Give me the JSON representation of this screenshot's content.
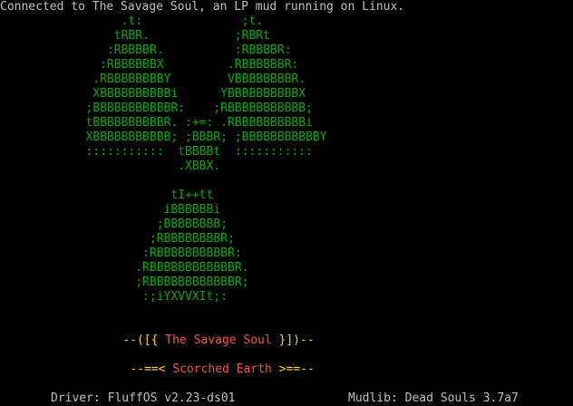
{
  "terminal": {
    "connect_message": "Connected to The Savage Soul, an LP mud running on Linux.",
    "art": [
      "              .t:              ;t.",
      "             tRBR.            ;RBRt",
      "            :RBBBBR.          :RBBBBR:",
      "           :RBBBBBBX         .RBBBBBBR:",
      "          .RBBBBBBBBY        VBBBBBBBBR.",
      "          XBBBBBBBBBBi      YBBBBBBBBBBX",
      "         ;BBBBBBBBBBBR:    ;RBBBBBBBBBBB;",
      "         tBBBBBBBBBBR. :+=: .RBBBBBBBBBBi",
      "         XBBBBBBBBBBB; ;BBBR; ;BBBBBBBBBBBY",
      "         :::::::::::  tBBBBt  :::::::::::",
      "                      .XBBX.",
      "",
      "                     tI++tt",
      "                    iBBBBBBi",
      "                   ;BBBBBBBB;",
      "                  ;RBBBBBBBBR;",
      "                 :RBBBBBBBBBBR:",
      "                .RBBBBBBBBBBBBR.",
      "                ;RBBBBBBBBBBBBR;",
      "                 :;iYXVVXIt;:"
    ],
    "title_line": {
      "prefix": "--([{ ",
      "name": "The Savage Soul",
      "suffix": " }])--"
    },
    "subtitle_line": {
      "prefix": "--==< ",
      "name": "Scorched Earth",
      "suffix": " >==--"
    },
    "driver_label": "Driver: FluffOS v2.23-ds01",
    "mudlib_label": "Mudlib: Dead Souls 3.7a7"
  },
  "colors": {
    "background": "#000000",
    "text": "#c0c0c0",
    "art": "#00b000",
    "frame": "#ffd800",
    "title": "#ff5050"
  }
}
